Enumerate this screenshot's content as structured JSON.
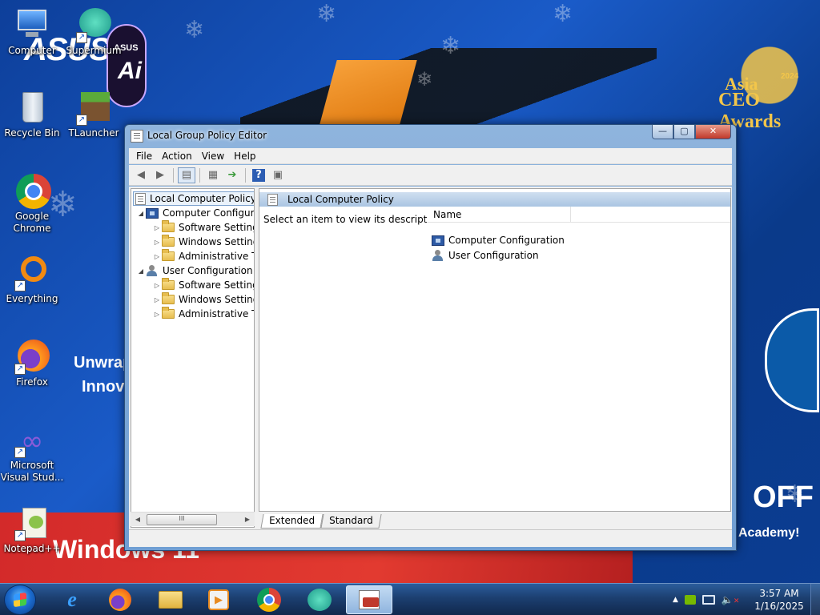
{
  "desktop": {
    "icons": [
      {
        "label": "Computer"
      },
      {
        "label": "Supermium"
      },
      {
        "label": "Recycle Bin"
      },
      {
        "label": "TLauncher"
      },
      {
        "label": "Google Chrome"
      },
      {
        "label": "Everything"
      },
      {
        "label": "Firefox"
      },
      {
        "label": "Microsoft Visual Stud..."
      },
      {
        "label": "Notepad++"
      }
    ],
    "wallpaper_text": {
      "brand": "ASUS",
      "ai_badge": "ASUS",
      "ai_mark": "Ai",
      "award_line1": "Asia",
      "award_line2": "CEO Awards",
      "award_year": "2024",
      "promo_left1": "Unwrap th",
      "promo_left2": "Innovat",
      "off": "OFF",
      "academy": "Academy!",
      "windows": "Windows 11"
    }
  },
  "window": {
    "title": "Local Group Policy Editor",
    "buttons": {
      "minimize": "—",
      "maximize": "▢",
      "close": "✕"
    },
    "menu": [
      "File",
      "Action",
      "View",
      "Help"
    ],
    "tree": {
      "root": "Local Computer Policy",
      "items": [
        {
          "label": "Computer Configura",
          "level": 1
        },
        {
          "label": "Software Settings",
          "level": 2
        },
        {
          "label": "Windows Setting",
          "level": 2
        },
        {
          "label": "Administrative Te",
          "level": 2
        },
        {
          "label": "User Configuration",
          "level": 1
        },
        {
          "label": "Software Settings",
          "level": 2
        },
        {
          "label": "Windows Setting",
          "level": 2
        },
        {
          "label": "Administrative Te",
          "level": 2
        }
      ],
      "scroll_thumb": "III"
    },
    "right_pane": {
      "header": "Local Computer Policy",
      "description": "Select an item to view its description.",
      "column_name": "Name",
      "rows": [
        "Computer Configuration",
        "User Configuration"
      ]
    },
    "tabs": [
      "Extended",
      "Standard"
    ]
  },
  "taskbar": {
    "time": "3:57 AM",
    "date": "1/16/2025"
  },
  "colors": {
    "accent": "#1a5bc8",
    "title_bar": "#8fb4dd",
    "taskbar": "#1c3f70"
  }
}
